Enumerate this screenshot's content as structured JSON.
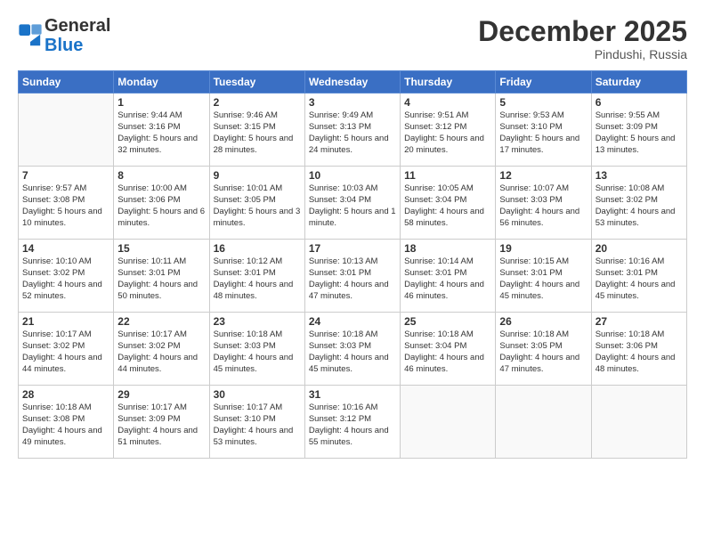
{
  "logo": {
    "line1": "General",
    "line2": "Blue"
  },
  "title": "December 2025",
  "subtitle": "Pindushi, Russia",
  "weekdays": [
    "Sunday",
    "Monday",
    "Tuesday",
    "Wednesday",
    "Thursday",
    "Friday",
    "Saturday"
  ],
  "weeks": [
    [
      {
        "day": "",
        "info": ""
      },
      {
        "day": "1",
        "info": "Sunrise: 9:44 AM\nSunset: 3:16 PM\nDaylight: 5 hours\nand 32 minutes."
      },
      {
        "day": "2",
        "info": "Sunrise: 9:46 AM\nSunset: 3:15 PM\nDaylight: 5 hours\nand 28 minutes."
      },
      {
        "day": "3",
        "info": "Sunrise: 9:49 AM\nSunset: 3:13 PM\nDaylight: 5 hours\nand 24 minutes."
      },
      {
        "day": "4",
        "info": "Sunrise: 9:51 AM\nSunset: 3:12 PM\nDaylight: 5 hours\nand 20 minutes."
      },
      {
        "day": "5",
        "info": "Sunrise: 9:53 AM\nSunset: 3:10 PM\nDaylight: 5 hours\nand 17 minutes."
      },
      {
        "day": "6",
        "info": "Sunrise: 9:55 AM\nSunset: 3:09 PM\nDaylight: 5 hours\nand 13 minutes."
      }
    ],
    [
      {
        "day": "7",
        "info": "Sunrise: 9:57 AM\nSunset: 3:08 PM\nDaylight: 5 hours\nand 10 minutes."
      },
      {
        "day": "8",
        "info": "Sunrise: 10:00 AM\nSunset: 3:06 PM\nDaylight: 5 hours\nand 6 minutes."
      },
      {
        "day": "9",
        "info": "Sunrise: 10:01 AM\nSunset: 3:05 PM\nDaylight: 5 hours\nand 3 minutes."
      },
      {
        "day": "10",
        "info": "Sunrise: 10:03 AM\nSunset: 3:04 PM\nDaylight: 5 hours\nand 1 minute."
      },
      {
        "day": "11",
        "info": "Sunrise: 10:05 AM\nSunset: 3:04 PM\nDaylight: 4 hours\nand 58 minutes."
      },
      {
        "day": "12",
        "info": "Sunrise: 10:07 AM\nSunset: 3:03 PM\nDaylight: 4 hours\nand 56 minutes."
      },
      {
        "day": "13",
        "info": "Sunrise: 10:08 AM\nSunset: 3:02 PM\nDaylight: 4 hours\nand 53 minutes."
      }
    ],
    [
      {
        "day": "14",
        "info": "Sunrise: 10:10 AM\nSunset: 3:02 PM\nDaylight: 4 hours\nand 52 minutes."
      },
      {
        "day": "15",
        "info": "Sunrise: 10:11 AM\nSunset: 3:01 PM\nDaylight: 4 hours\nand 50 minutes."
      },
      {
        "day": "16",
        "info": "Sunrise: 10:12 AM\nSunset: 3:01 PM\nDaylight: 4 hours\nand 48 minutes."
      },
      {
        "day": "17",
        "info": "Sunrise: 10:13 AM\nSunset: 3:01 PM\nDaylight: 4 hours\nand 47 minutes."
      },
      {
        "day": "18",
        "info": "Sunrise: 10:14 AM\nSunset: 3:01 PM\nDaylight: 4 hours\nand 46 minutes."
      },
      {
        "day": "19",
        "info": "Sunrise: 10:15 AM\nSunset: 3:01 PM\nDaylight: 4 hours\nand 45 minutes."
      },
      {
        "day": "20",
        "info": "Sunrise: 10:16 AM\nSunset: 3:01 PM\nDaylight: 4 hours\nand 45 minutes."
      }
    ],
    [
      {
        "day": "21",
        "info": "Sunrise: 10:17 AM\nSunset: 3:02 PM\nDaylight: 4 hours\nand 44 minutes."
      },
      {
        "day": "22",
        "info": "Sunrise: 10:17 AM\nSunset: 3:02 PM\nDaylight: 4 hours\nand 44 minutes."
      },
      {
        "day": "23",
        "info": "Sunrise: 10:18 AM\nSunset: 3:03 PM\nDaylight: 4 hours\nand 45 minutes."
      },
      {
        "day": "24",
        "info": "Sunrise: 10:18 AM\nSunset: 3:03 PM\nDaylight: 4 hours\nand 45 minutes."
      },
      {
        "day": "25",
        "info": "Sunrise: 10:18 AM\nSunset: 3:04 PM\nDaylight: 4 hours\nand 46 minutes."
      },
      {
        "day": "26",
        "info": "Sunrise: 10:18 AM\nSunset: 3:05 PM\nDaylight: 4 hours\nand 47 minutes."
      },
      {
        "day": "27",
        "info": "Sunrise: 10:18 AM\nSunset: 3:06 PM\nDaylight: 4 hours\nand 48 minutes."
      }
    ],
    [
      {
        "day": "28",
        "info": "Sunrise: 10:18 AM\nSunset: 3:08 PM\nDaylight: 4 hours\nand 49 minutes."
      },
      {
        "day": "29",
        "info": "Sunrise: 10:17 AM\nSunset: 3:09 PM\nDaylight: 4 hours\nand 51 minutes."
      },
      {
        "day": "30",
        "info": "Sunrise: 10:17 AM\nSunset: 3:10 PM\nDaylight: 4 hours\nand 53 minutes."
      },
      {
        "day": "31",
        "info": "Sunrise: 10:16 AM\nSunset: 3:12 PM\nDaylight: 4 hours\nand 55 minutes."
      },
      {
        "day": "",
        "info": ""
      },
      {
        "day": "",
        "info": ""
      },
      {
        "day": "",
        "info": ""
      }
    ]
  ]
}
